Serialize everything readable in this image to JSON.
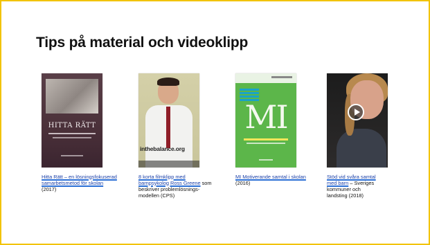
{
  "slide": {
    "title": "Tips på material och videoklipp"
  },
  "items": [
    {
      "thumb_title": "HITTA RÄTT",
      "link": "Hitta Rätt – en lösningsfokuserad samarbetsmetod för skolan",
      "rest": " (2017)"
    },
    {
      "thumb_text": "inthebalance.org",
      "link": "8 korta filmklipp med barnpsykolog Ross Greene",
      "rest": " som beskriver problemlösnings-modellen (CPS)"
    },
    {
      "thumb_title": "MI",
      "link": "MI Motiverande samtal i skolan",
      "rest": " (2016)"
    },
    {
      "link": "Stöd vid svåra samtal med barn",
      "rest": " – Sveriges kommuner och landsting (2018)"
    }
  ]
}
